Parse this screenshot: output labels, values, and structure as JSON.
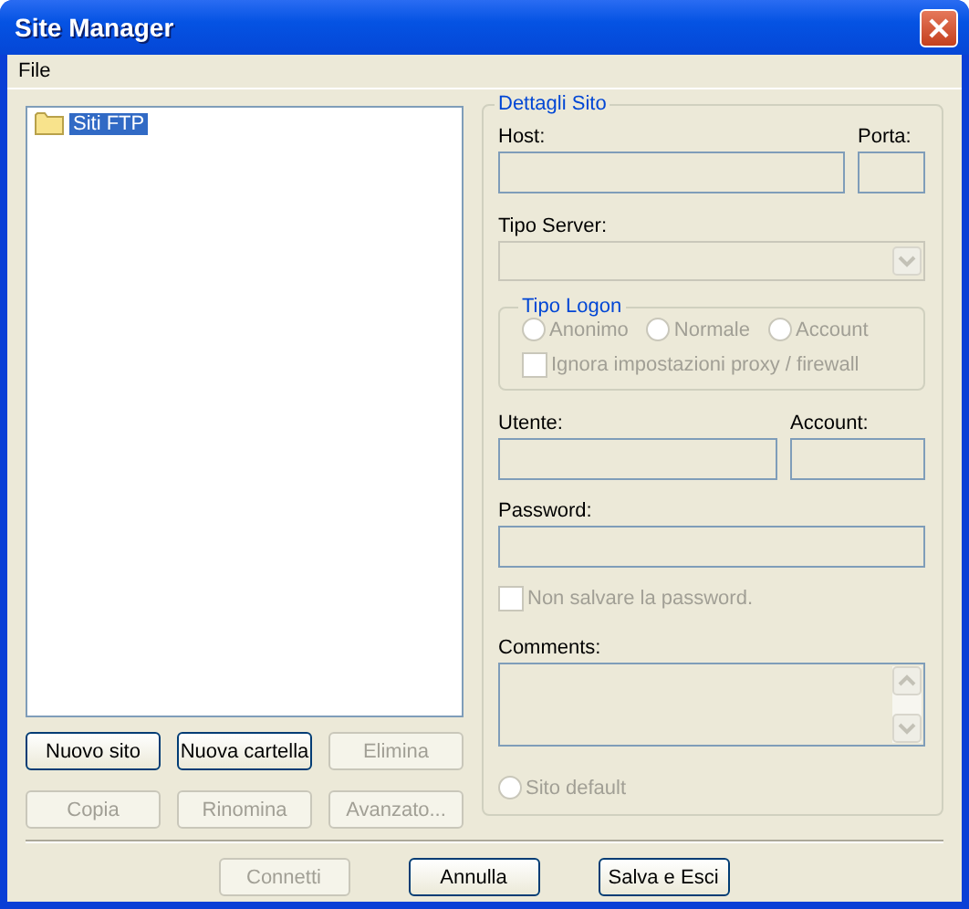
{
  "window": {
    "title": "Site Manager"
  },
  "menu": [
    {
      "label": "File"
    }
  ],
  "tree": [
    {
      "label": "Siti FTP",
      "selected": true
    }
  ],
  "site_buttons": [
    {
      "label": "Nuovo sito",
      "disabled": false
    },
    {
      "label": "Nuova cartella",
      "disabled": false
    },
    {
      "label": "Elimina",
      "disabled": true
    },
    {
      "label": "Copia",
      "disabled": true
    },
    {
      "label": "Rinomina",
      "disabled": true
    },
    {
      "label": "Avanzato...",
      "disabled": true
    }
  ],
  "details": {
    "title": "Dettagli Sito",
    "host_label": "Host:",
    "port_label": "Porta:",
    "server_type_label": "Tipo Server:",
    "logon": {
      "title": "Tipo Logon",
      "options": [
        {
          "label": "Anonimo",
          "selected": false,
          "disabled": true
        },
        {
          "label": "Normale",
          "selected": false,
          "disabled": true
        },
        {
          "label": "Account",
          "selected": false,
          "disabled": true
        }
      ],
      "proxy": {
        "label": "Ignora impostazioni proxy / firewall",
        "checked": false,
        "disabled": true
      }
    },
    "user_label": "Utente:",
    "account_label": "Account:",
    "password_label": "Password:",
    "no_save": {
      "label": "Non salvare la password.",
      "checked": false,
      "disabled": true
    },
    "comments_label": "Comments:",
    "default_site": {
      "label": "Sito default",
      "selected": false,
      "disabled": true
    }
  },
  "dialog_buttons": [
    {
      "label": "Connetti",
      "disabled": true
    },
    {
      "label": "Annulla",
      "disabled": false
    },
    {
      "label": "Salva e Esci",
      "disabled": false
    }
  ]
}
